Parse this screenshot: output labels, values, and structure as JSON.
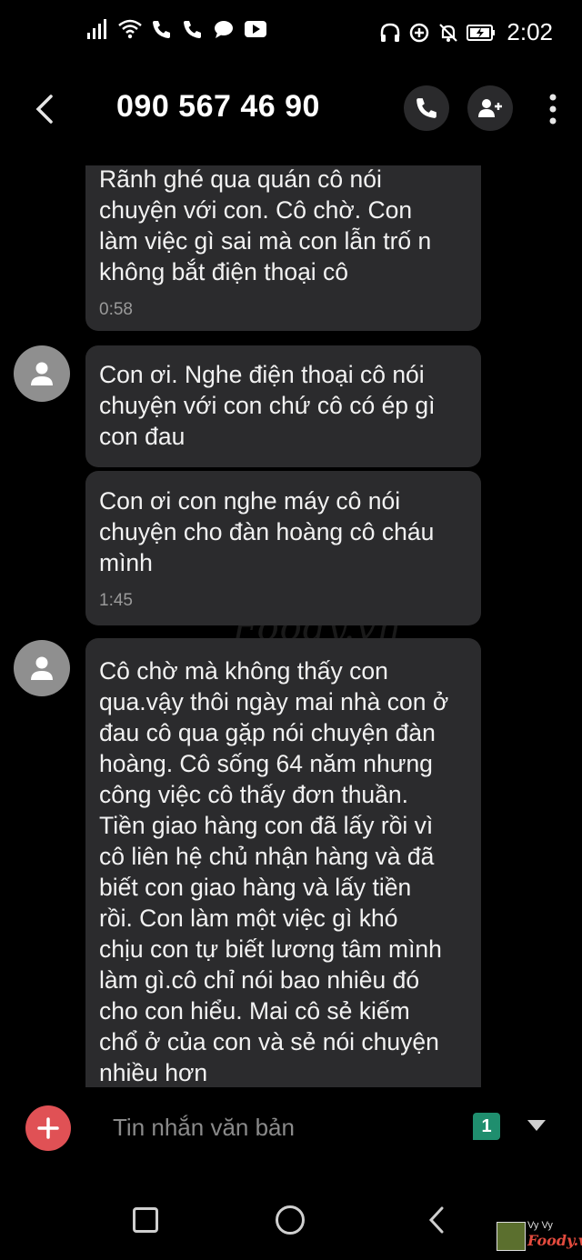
{
  "status_bar": {
    "time": "2:02",
    "icons": [
      "signal-icon",
      "wifi-icon",
      "missed-call-icon",
      "missed-call-icon",
      "chat-bubble-icon",
      "youtube-icon",
      "headphones-icon",
      "data-saver-icon",
      "mute-icon",
      "battery-charging-icon"
    ]
  },
  "header": {
    "title": "090 567 46 90",
    "back_icon": "back-arrow-icon",
    "call_icon": "phone-icon",
    "add_contact_icon": "add-contact-icon",
    "more_icon": "more-vert-icon"
  },
  "messages": [
    {
      "text": "Rãnh ghé qua quán cô nói\nchuyện với con. Cô chờ. Con\nlàm việc gì sai mà con lẫn trố n\nkhông bắt điện thoại cô",
      "time": "0:58"
    },
    {
      "text": "Con ơi. Nghe điện thoại cô nói\nchuyện với  con chứ cô có ép gì\ncon đau",
      "time": ""
    },
    {
      "text": "Con ơi con nghe máy cô nói\nchuyện cho đàn  hoàng cô cháu\nmình",
      "time": "1:45"
    },
    {
      "text": "Cô chờ mà không thấy con\nqua.vậy thôi ngày mai nhà con ở\nđau cô qua gặp nói chuyện đàn\nhoàng. Cô sống 64 năm nhưng\ncông việc cô thấy đơn thuần.\nTiền giao hàng con đã lấy rồi vì\ncô liên hệ chủ nhận hàng và đã\nbiết con giao hàng và lấy tiền\nrồi. Con làm một việc gì khó\nchịu con tự biết lương tâm mình\nlàm gì.cô chỉ nói bao nhiêu đó\ncho con hiểu. Mai cô sẻ kiếm\nchổ ở của con và sẻ nói chuyện\nnhiều hơn",
      "time": ""
    }
  ],
  "watermark": "Foody.vn",
  "compose": {
    "placeholder": "Tin nhắn văn bản",
    "sim_number": "1",
    "attach_icon": "plus-icon"
  },
  "navbar": {
    "icons": [
      "recents-icon",
      "home-icon",
      "back-icon"
    ]
  },
  "corner_stamp": {
    "name": "Vy Vy",
    "brand": "Foody.vn"
  },
  "colors": {
    "bubble": "#2b2b2d",
    "avatar": "#8f8f8f",
    "attach": "#e05155",
    "sim_badge": "#1f8e6e"
  }
}
